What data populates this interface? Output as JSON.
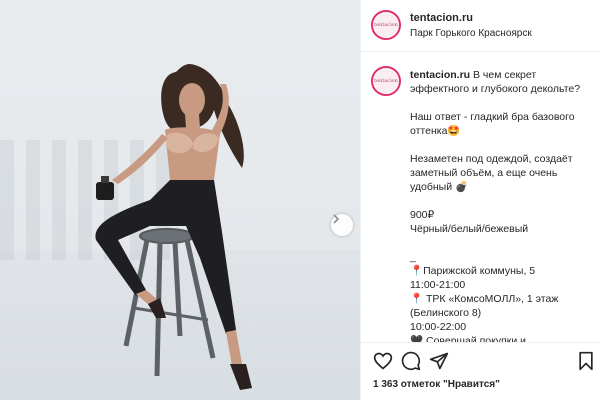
{
  "post": {
    "username": "tentacion.ru",
    "location": "Парк Горького Красноярск",
    "avatar_text": "tentacion",
    "caption_user": "tentacion.ru",
    "caption_text": " В чем секрет эффектного и глубокого декольте?\n\nНаш ответ - гладкий бра базового оттенка🤩\n\nНезаметен под одеждой, создаёт заметный объём, а еще очень удобный 💣\n\n900₽\nЧёрный/белый/бежевый\n\n_\n📍Парижской коммуны, 5\n11:00-21:00\n📍 ТРК «КомсоМОЛЛ», 1 этаж (Белинского 8)\n10:00-22:00\n🖤 Совершай покупки и консультируйся любым способом",
    "likes": "1 363 отметок \"Нравится\""
  },
  "icons": {
    "like": "heart-icon",
    "comment": "comment-icon",
    "share": "share-icon",
    "save": "bookmark-icon",
    "next": "chevron-right-icon"
  },
  "colors": {
    "avatar_ring": "#e1306c",
    "text": "#262626"
  }
}
